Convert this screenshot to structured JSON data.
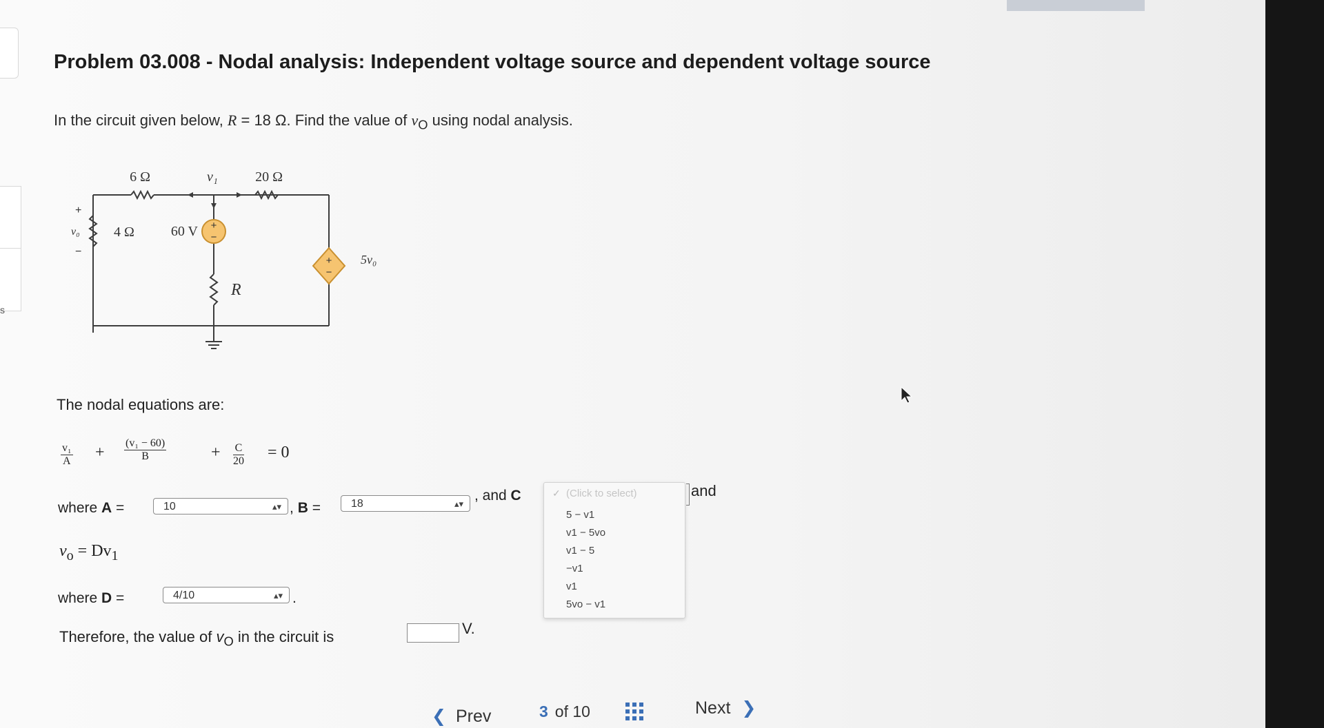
{
  "problem": {
    "title": "Problem 03.008 - Nodal analysis: Independent voltage source and dependent voltage source",
    "intro_prefix": "In the circuit given below, ",
    "r_symbol": "R",
    "r_value": " = 18 Ω",
    "intro_mid": ". Find the value of ",
    "vo_symbol": "v",
    "vo_sub": "O",
    "intro_suffix": " using nodal analysis."
  },
  "circuit": {
    "r1_label": "6 Ω",
    "r2_label": "20 Ω",
    "r3_label": "4 Ω",
    "r4_label": "R",
    "node_label": "v₁",
    "source_label": "60 V",
    "dep_source_label": "5v₀",
    "vo_label": "v₀",
    "plus": "+",
    "minus": "−",
    "colors": {
      "wire": "#3c3c3c",
      "source_fill": "#f6c470",
      "source_stroke": "#c99030"
    }
  },
  "equations": {
    "intro": "The nodal equations are:",
    "eq1": {
      "t1_num": "v₁",
      "t1_den": "A",
      "plus1": "+",
      "t2_num": "(v₁ − 60)",
      "t2_den": "B",
      "plus2": "+",
      "t3_num": "C",
      "t3_den": "20",
      "equals": "= 0"
    },
    "where_label": "where ",
    "a_label": "A",
    "eq_sign": " =",
    "a_value": "10",
    "b_label": "B",
    "b_value": "18",
    "sep_comma": ",",
    "and_c_label": ", and ",
    "c_label": "C",
    "and_after": "and",
    "vo_eq_lhs": "v",
    "vo_eq_sub": "o",
    "vo_eq_rhs": " = Dv",
    "vo_eq_rhs_sub": "1",
    "d_label": "D",
    "d_value": "4/10",
    "period": "."
  },
  "dropdown": {
    "placeholder": "(Click to select)",
    "check": "✓",
    "options": [
      "5 − v1",
      "v1 − 5vo",
      "v1 − 5",
      "−v1",
      "v1",
      "5vo − v1"
    ]
  },
  "answer": {
    "prefix": "Therefore, the value of ",
    "vo_symbol": "v",
    "vo_sub": "O",
    "suffix": " in the circuit is",
    "unit": "V."
  },
  "nav": {
    "prev_chevron": "❮",
    "prev": "Prev",
    "page_current": "3",
    "page_of": "of 10",
    "next": "Next",
    "next_chevron": "❯",
    "accent": "#3b6fb6"
  },
  "side": {
    "letter": "s"
  }
}
